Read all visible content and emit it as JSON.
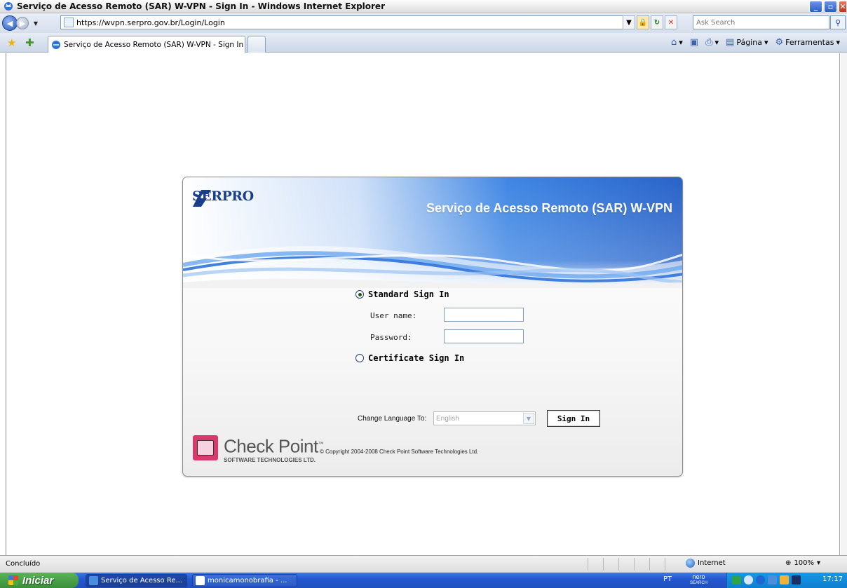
{
  "window": {
    "title": "Serviço de Acesso Remoto (SAR) W-VPN - Sign In - Windows Internet Explorer"
  },
  "addressbar": {
    "url": "https://wvpn.serpro.gov.br/Login/Login",
    "search_placeholder": "Ask Search"
  },
  "tabs": [
    {
      "label": "Serviço de Acesso Remoto (SAR) W-VPN - Sign In"
    }
  ],
  "commandbar": {
    "page": "Página",
    "tools": "Ferramentas"
  },
  "login": {
    "brand": "SERPRO",
    "heading": "Serviço de Acesso Remoto (SAR) W-VPN",
    "standard_signin": "Standard Sign In",
    "username_label": "User name:",
    "password_label": "Password:",
    "certificate_signin": "Certificate Sign In",
    "language_label": "Change Language To:",
    "language_value": "English",
    "signin_button": "Sign In",
    "vendor_name": "Check Point",
    "vendor_tm": "™",
    "vendor_sub": "SOFTWARE TECHNOLOGIES LTD.",
    "copyright": "© Copyright 2004-2008   Check Point Software Technologies Ltd."
  },
  "statusbar": {
    "text": "Concluído",
    "zone": "Internet",
    "zoom": "100%"
  },
  "taskbar": {
    "start": "Iniciar",
    "tasks": [
      {
        "label": "Serviço de Acesso Re..."
      },
      {
        "label": "monicamonobrafia - ..."
      }
    ],
    "language": "PT",
    "nero_top": "nero",
    "nero_bottom": "SEARCH",
    "clock": "17:17"
  },
  "colors": {
    "brand_blue": "#1a3e8c",
    "banner_blue": "#2f6fd6",
    "taskbar_blue": "#2459d2",
    "start_green": "#3a8f38"
  }
}
